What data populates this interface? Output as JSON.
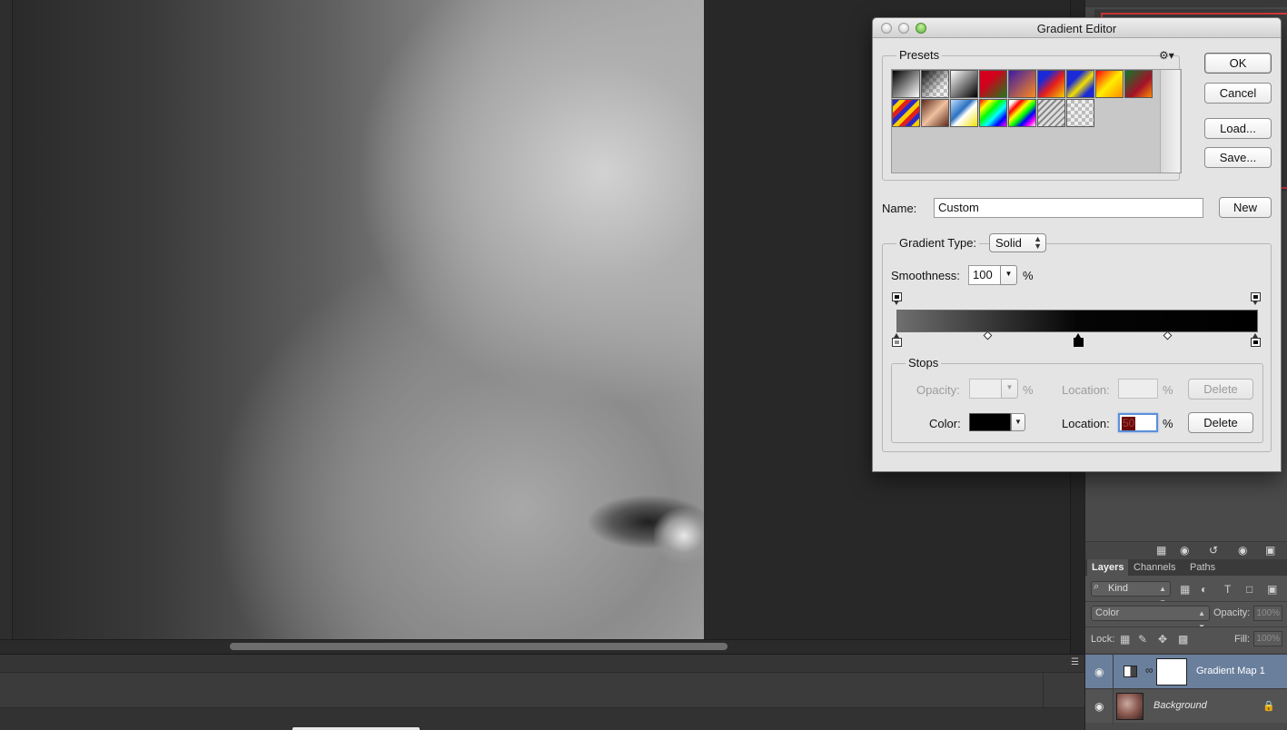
{
  "dialog": {
    "title": "Gradient Editor",
    "presets_label": "Presets",
    "gear_icon": "gear-icon",
    "buttons": {
      "ok": "OK",
      "cancel": "Cancel",
      "load": "Load...",
      "save": "Save...",
      "new": "New"
    },
    "name_label": "Name:",
    "name_value": "Custom",
    "gradient_type_label": "Gradient Type:",
    "gradient_type_value": "Solid",
    "smoothness_label": "Smoothness:",
    "smoothness_value": "100",
    "percent": "%",
    "stops_label": "Stops",
    "opacity_label": "Opacity:",
    "location_label": "Location:",
    "color_label": "Color:",
    "delete_label": "Delete",
    "color_location_value": "50",
    "color_stop_value": "#000000",
    "gradient": {
      "start_color": "#6f6f6f",
      "mid_color": "#050505",
      "end_color": "#000000"
    }
  },
  "layers_panel": {
    "tabs": [
      "Layers",
      "Channels",
      "Paths"
    ],
    "active_tab": "Layers",
    "kind_label": "Kind",
    "blend_mode": "Color",
    "opacity_label": "Opacity:",
    "opacity_value": "100%",
    "lock_label": "Lock:",
    "fill_label": "Fill:",
    "fill_value": "100%",
    "layers": [
      {
        "name": "Gradient Map 1",
        "selected": true
      },
      {
        "name": "Background",
        "locked": true
      }
    ]
  },
  "colors": {
    "selection": "#6a7f9c",
    "accent_focus": "#5d8fd8",
    "nav_frame": "#d9393a"
  }
}
